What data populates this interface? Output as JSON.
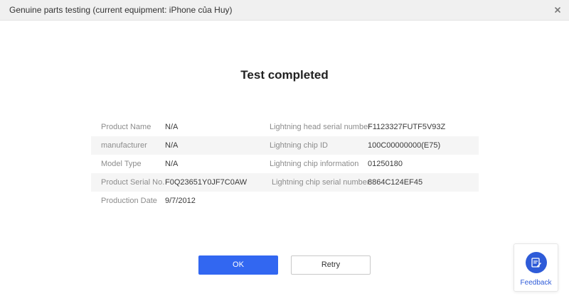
{
  "window": {
    "title": "Genuine parts testing (current equipment: iPhone của Huy)",
    "close_icon": "close-icon"
  },
  "heading": "Test completed",
  "info_rows": [
    {
      "left_label": "Product Name",
      "left_value": "N/A",
      "right_label": "Lightning head serial number",
      "right_value": "F1123327FUTF5V93Z"
    },
    {
      "left_label": "manufacturer",
      "left_value": "N/A",
      "right_label": "Lightning chip ID",
      "right_value": "100C00000000(E75)"
    },
    {
      "left_label": "Model Type",
      "left_value": "N/A",
      "right_label": "Lightning chip information",
      "right_value": "01250180"
    },
    {
      "left_label": "Product Serial No.",
      "left_value": "F0Q23651Y0JF7C0AW",
      "right_label": "Lightning chip serial number",
      "right_value": "8864C124EF45"
    },
    {
      "left_label": "Production Date",
      "left_value": "9/7/2012"
    }
  ],
  "buttons": {
    "ok_label": "OK",
    "retry_label": "Retry"
  },
  "feedback": {
    "label": "Feedback",
    "icon": "feedback-icon"
  },
  "colors": {
    "primary": "#3267f1",
    "feedback_accent": "#2e5bd8",
    "row_shade": "#f5f5f5",
    "titlebar": "#f0f0f0"
  }
}
